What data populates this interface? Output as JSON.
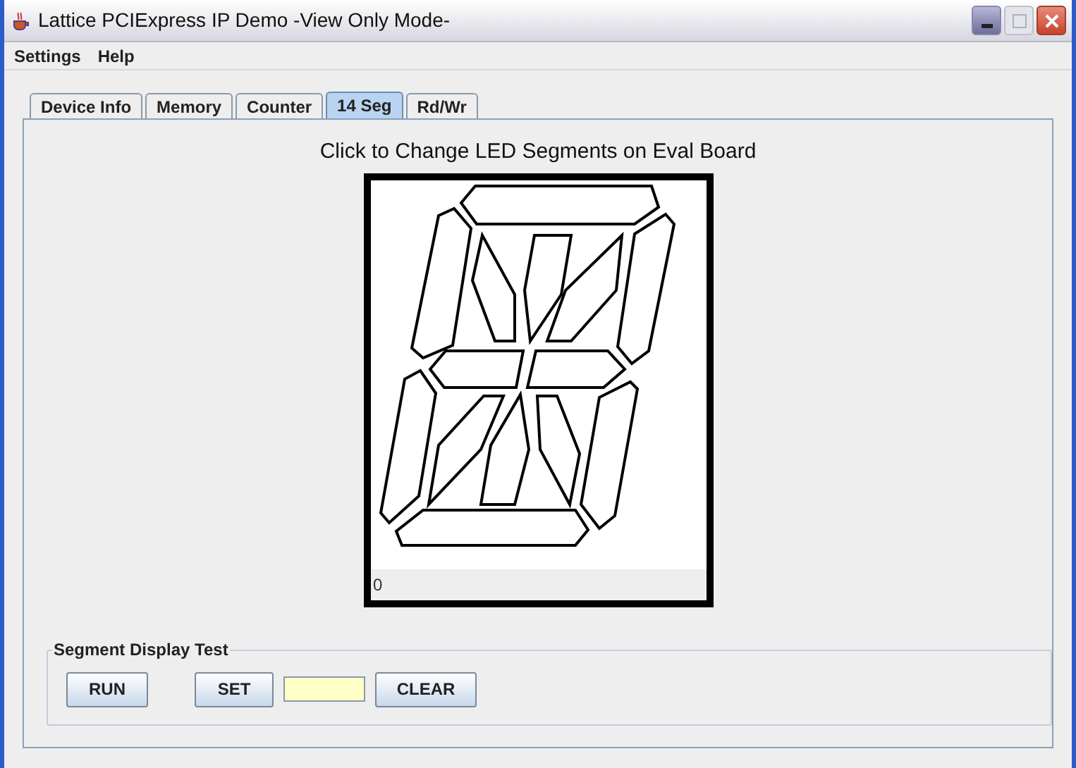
{
  "window": {
    "title": "Lattice PCIExpress IP Demo -View Only Mode-"
  },
  "menu": [
    "Settings",
    "Help"
  ],
  "tabs": [
    {
      "label": "Device Info",
      "selected": false
    },
    {
      "label": "Memory",
      "selected": false
    },
    {
      "label": "Counter",
      "selected": false
    },
    {
      "label": "14 Seg",
      "selected": true
    },
    {
      "label": "Rd/Wr",
      "selected": false
    }
  ],
  "instruction": "Click to Change LED Segments on Eval Board",
  "display": {
    "reading": "0",
    "segments": [
      {
        "lit": false
      },
      {
        "lit": false
      },
      {
        "lit": false
      },
      {
        "lit": false
      },
      {
        "lit": false
      },
      {
        "lit": false
      },
      {
        "lit": false
      },
      {
        "lit": false
      },
      {
        "lit": false
      },
      {
        "lit": false
      },
      {
        "lit": false
      },
      {
        "lit": false
      },
      {
        "lit": false
      },
      {
        "lit": false
      }
    ]
  },
  "test_group": {
    "title": "Segment Display Test",
    "run_button": "RUN",
    "set_button": "SET",
    "clear_button": "CLEAR"
  }
}
